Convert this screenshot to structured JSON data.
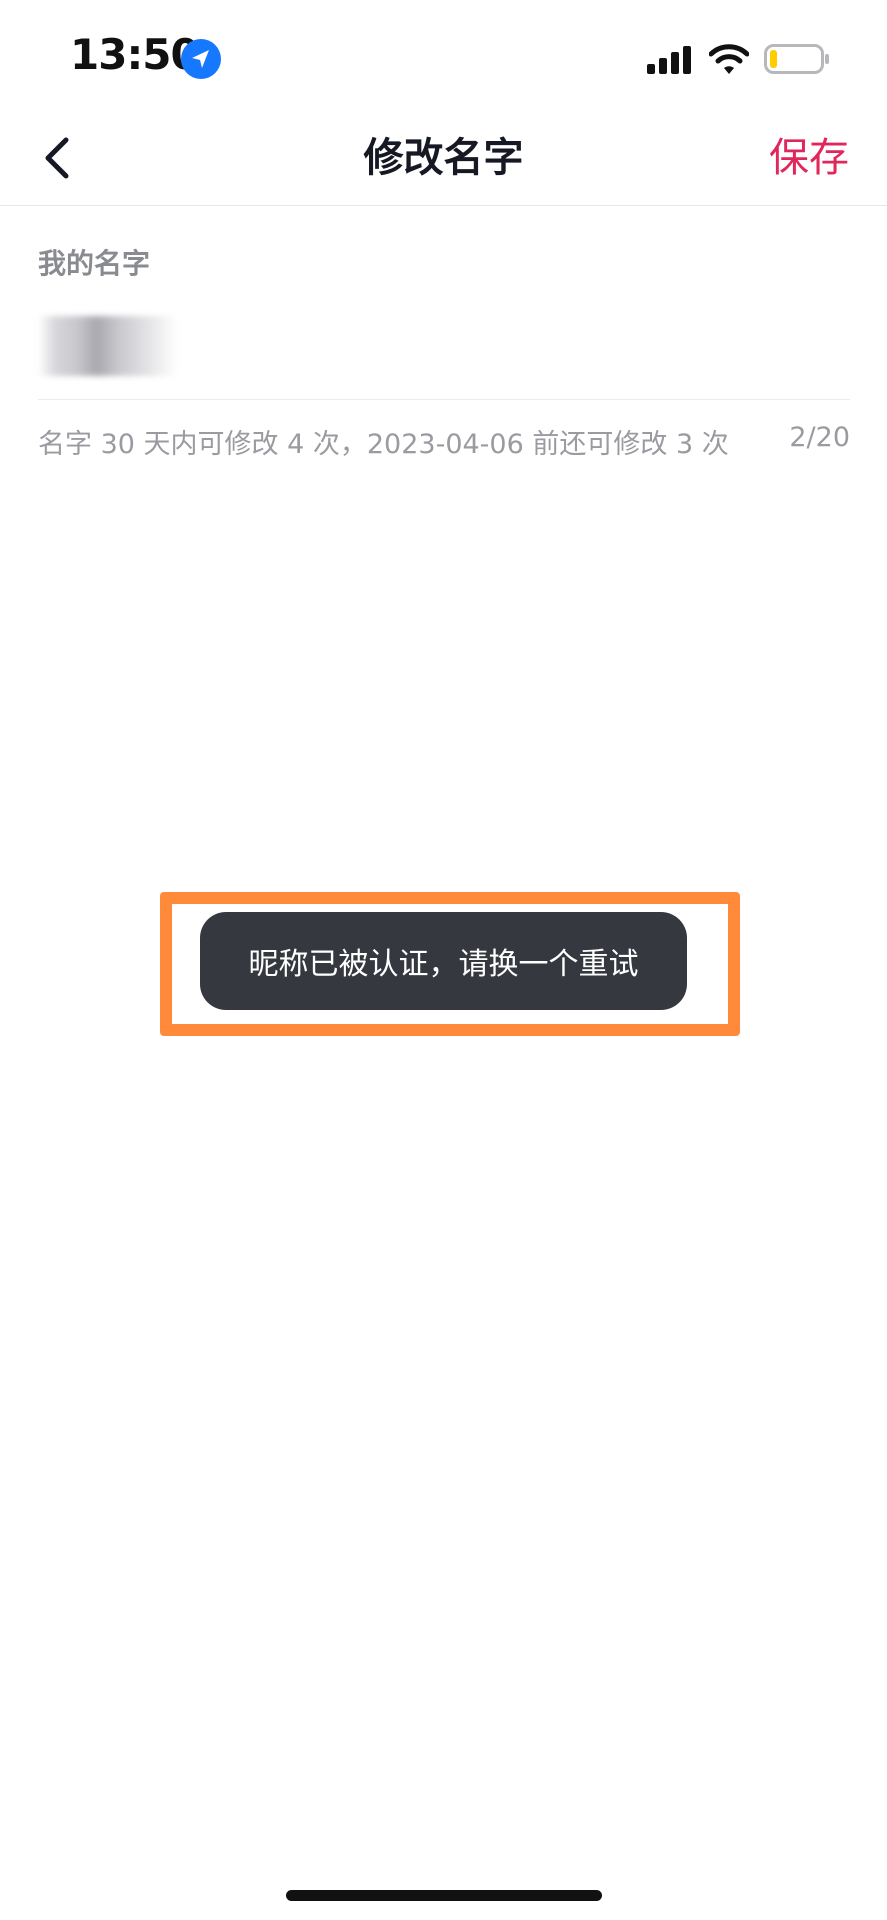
{
  "status_bar": {
    "time": "13:50",
    "icons": [
      "location-arrow-icon",
      "cellular-signal-icon",
      "wifi-icon",
      "battery-icon"
    ],
    "battery_level": 0.15,
    "location_color": "#1677ff",
    "battery_color": "#ffcc00"
  },
  "nav": {
    "title": "修改名字",
    "save_label": "保存",
    "back_icon": "chevron-left-icon",
    "accent_color": "#e1265c"
  },
  "form": {
    "label": "我的名字",
    "name_value": "",
    "hint": "名字 30 天内可修改 4 次，2023-04-06 前还可修改 3 次",
    "counter": "2/20"
  },
  "toast": {
    "message": "昵称已被认证，请换一个重试",
    "highlight_color": "#ff8b3a"
  }
}
